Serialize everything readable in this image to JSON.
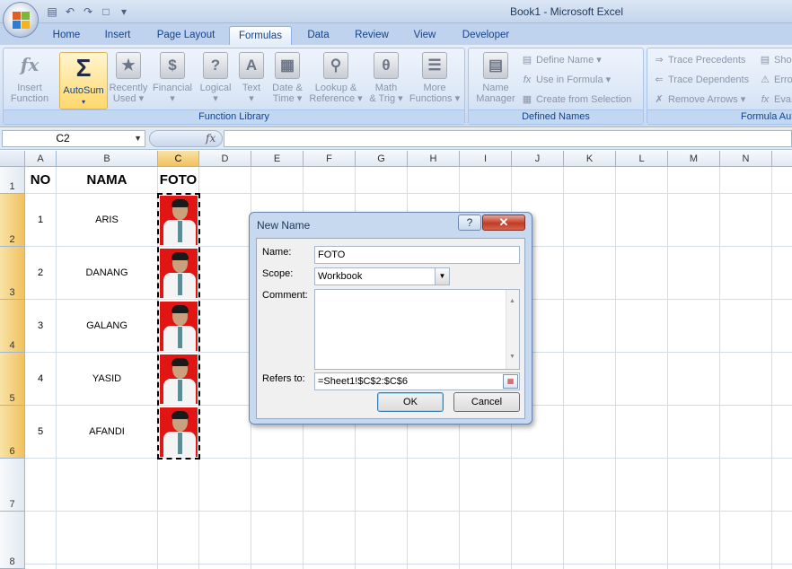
{
  "window": {
    "title": "Book1 - Microsoft Excel"
  },
  "ribbon_tabs": [
    "Home",
    "Insert",
    "Page Layout",
    "Formulas",
    "Data",
    "Review",
    "View",
    "Developer"
  ],
  "active_tab": "Formulas",
  "function_library": {
    "label": "Function Library",
    "insert_function": [
      "Insert",
      "Function"
    ],
    "autosum": "AutoSum",
    "recently_used": [
      "Recently",
      "Used"
    ],
    "financial": "Financial",
    "logical": "Logical",
    "text": "Text",
    "date_time": [
      "Date &",
      "Time"
    ],
    "lookup_reference": [
      "Lookup &",
      "Reference"
    ],
    "math_trig": [
      "Math",
      "& Trig"
    ],
    "more_functions": [
      "More",
      "Functions"
    ]
  },
  "defined_names": {
    "label": "Defined Names",
    "name_manager": [
      "Name",
      "Manager"
    ],
    "define_name": "Define Name",
    "use_in_formula": "Use in Formula",
    "create_from_selection": "Create from Selection"
  },
  "formula_auditing": {
    "label": "Formula Au",
    "trace_precedents": "Trace Precedents",
    "trace_dependents": "Trace Dependents",
    "remove_arrows": "Remove Arrows",
    "show": "Sho",
    "error": "Erro",
    "evaluate": "Eva"
  },
  "formula_bar": {
    "name_box": "C2",
    "fx": "fx",
    "formula": ""
  },
  "columns": [
    "A",
    "B",
    "C",
    "D",
    "E",
    "F",
    "G",
    "H",
    "I",
    "J",
    "K",
    "L",
    "M",
    "N"
  ],
  "rows": [
    "1",
    "2",
    "3",
    "4",
    "5",
    "6",
    "7",
    "8"
  ],
  "sheet": {
    "headers": {
      "no": "NO",
      "nama": "NAMA",
      "foto": "FOTO"
    },
    "records": [
      {
        "no": "1",
        "nama": "ARIS"
      },
      {
        "no": "2",
        "nama": "DANANG"
      },
      {
        "no": "3",
        "nama": "GALANG"
      },
      {
        "no": "4",
        "nama": "YASID"
      },
      {
        "no": "5",
        "nama": "AFANDI"
      }
    ]
  },
  "dialog": {
    "title": "New Name",
    "help": "?",
    "close": "✕",
    "name_label": "Name:",
    "name_value": "FOTO",
    "scope_label": "Scope:",
    "scope_value": "Workbook",
    "comment_label": "Comment:",
    "refers_label": "Refers to:",
    "refers_value": "=Sheet1!$C$2:$C$6",
    "ok": "OK",
    "cancel": "Cancel"
  }
}
